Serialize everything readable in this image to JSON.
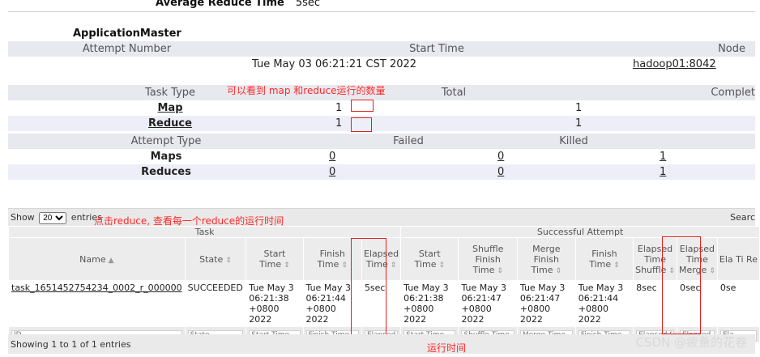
{
  "top": {
    "clipped_label": "Average Reduce Time",
    "clipped_value": "5sec"
  },
  "am": {
    "title": "ApplicationMaster",
    "headers": [
      "Attempt Number",
      "Start Time",
      "Node"
    ],
    "start_time": "Tue May 03 06:21:21 CST 2022",
    "node": "hadoop01:8042"
  },
  "tasks": {
    "headers": [
      "Task Type",
      "Total",
      "Complet"
    ],
    "rows": [
      {
        "type": "Map",
        "total": "1",
        "complete": "1"
      },
      {
        "type": "Reduce",
        "total": "1",
        "complete": "1"
      }
    ]
  },
  "attempts": {
    "headers": [
      "Attempt Type",
      "Failed",
      "Killed"
    ],
    "rows": [
      {
        "type": "Maps",
        "c1": "0",
        "c2": "0",
        "c3": "1"
      },
      {
        "type": "Reduces",
        "c1": "0",
        "c2": "0",
        "c3": "1"
      }
    ]
  },
  "annotations": {
    "count_note": "可以看到 map 和reduce运行的数量",
    "click_note": "点击reduce, 查看每一个reduce的运行时间",
    "runtime_note": "运行时间"
  },
  "datatable": {
    "show_label": "Show",
    "entries_label": "entries",
    "page_size": "20",
    "search_label": "Searc",
    "group_task": "Task",
    "group_success": "Successful Attempt",
    "columns": [
      "Name",
      "State",
      "Start Time",
      "Finish Time",
      "Elapsed Time",
      "Start Time",
      "Shuffle Finish Time",
      "Merge Finish Time",
      "Finish Time",
      "Elapsed Time Shuffle",
      "Elapsed Time Merge",
      "Ela Ti Re"
    ],
    "row": {
      "name": "task_1651452754234_0002_r_000000",
      "state": "SUCCEEDED",
      "start": "Tue May 3 06:21:38 +0800 2022",
      "finish": "Tue May 3 06:21:44 +0800 2022",
      "elapsed": "5sec",
      "att_start": "Tue May 3 06:21:38 +0800 2022",
      "shuffle_finish": "Tue May 3 06:21:47 +0800 2022",
      "merge_finish": "Tue May 3 06:21:47 +0800 2022",
      "att_finish": "Tue May 3 06:21:44 +0800 2022",
      "elapsed_shuffle": "8sec",
      "elapsed_merge": "0sec",
      "elapsed_reduce": "0se"
    },
    "filters": [
      "ID",
      "State",
      "Start Time",
      "Finish Time",
      "Elapsed",
      "Start Time",
      "Shuffle Time",
      "Merge Time",
      "Finish Time",
      "Elapsed S",
      "Elapsed I",
      "Ela"
    ],
    "info": "Showing 1 to 1 of 1 entries"
  },
  "watermark": "CSDN @疲惫的花卷",
  "colors": {
    "annotation": "#ff2a2a",
    "header_bg": "#e8e8ef",
    "alt_row": "#eeeef8"
  }
}
